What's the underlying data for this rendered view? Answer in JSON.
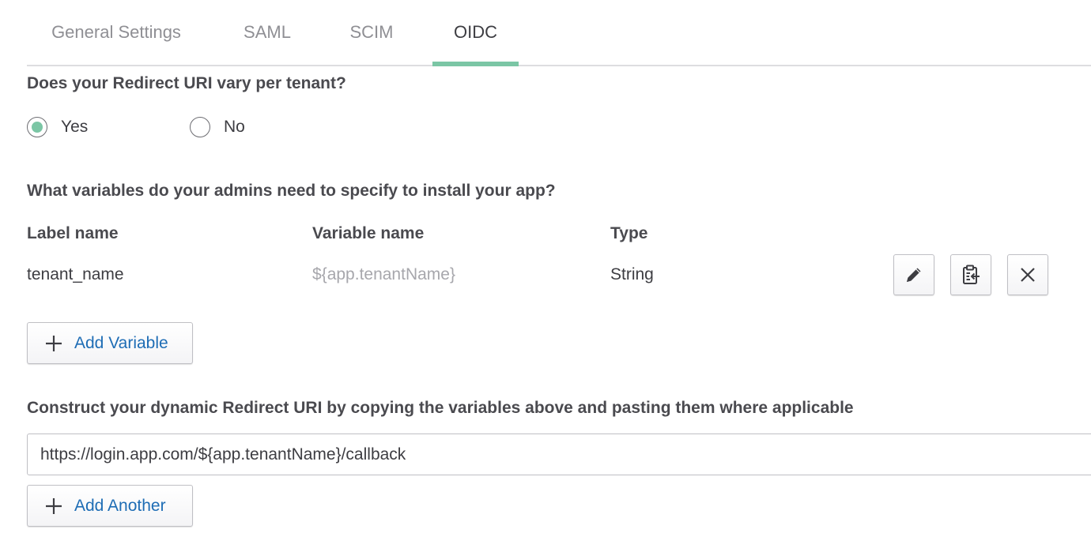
{
  "tabs": [
    {
      "label": "General Settings",
      "active": false
    },
    {
      "label": "SAML",
      "active": false
    },
    {
      "label": "SCIM",
      "active": false
    },
    {
      "label": "OIDC",
      "active": true
    }
  ],
  "redirect_question": "Does your Redirect URI vary per tenant?",
  "radio": {
    "yes_label": "Yes",
    "no_label": "No",
    "selected": "Yes"
  },
  "variables_question": "What variables do your admins need to specify to install your app?",
  "table": {
    "headers": [
      "Label name",
      "Variable name",
      "Type"
    ],
    "rows": [
      {
        "label_name": "tenant_name",
        "variable_name": "${app.tenantName}",
        "type": "String"
      }
    ]
  },
  "add_variable_label": "Add Variable",
  "construct_question": "Construct your dynamic Redirect URI by copying the variables above and pasting them where applicable",
  "uri_value": "https://login.app.com/${app.tenantName}/callback",
  "add_another_label": "Add Another",
  "colors": {
    "accent_green": "#7bc6a5",
    "link_blue": "#1e6db5"
  },
  "icons": {
    "edit": "pencil-icon",
    "copy": "clipboard-copy-icon",
    "remove": "close-icon",
    "add": "plus-icon"
  }
}
